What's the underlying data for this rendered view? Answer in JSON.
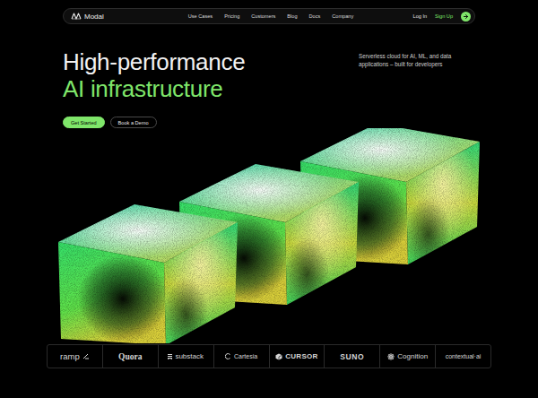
{
  "nav": {
    "brand": "Modal",
    "links": [
      "Use Cases",
      "Pricing",
      "Customers",
      "Blog",
      "Docs",
      "Company"
    ],
    "login": "Log In",
    "signup": "Sign Up"
  },
  "hero": {
    "title_lines": [
      {
        "text": "High-performance",
        "accent": false
      },
      {
        "text": "AI infrastructure",
        "accent": true
      }
    ],
    "tagline": "Serverless cloud for AI, ML, and data applications – built for developers",
    "buttons": [
      {
        "label": "Get Started",
        "primary": true
      },
      {
        "label": "Book a Demo",
        "primary": false
      }
    ]
  },
  "customers": [
    "ramp",
    "Quora",
    "substack",
    "Cartesia",
    "CURSOR",
    "SUNO",
    "Cognition",
    "contextual·ai"
  ]
}
